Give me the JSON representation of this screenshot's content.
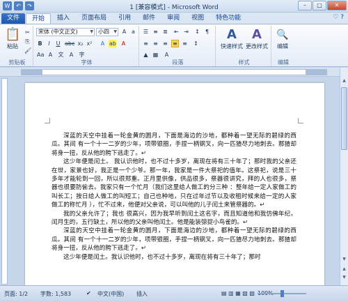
{
  "window": {
    "title": "1 [兼容模式] - Microsoft Word",
    "min_glyph": "–",
    "max_glyph": "□",
    "close_glyph": "✕"
  },
  "qat": {
    "save_glyph": "W",
    "undo_glyph": "↶",
    "redo_glyph": "↷"
  },
  "tabs": [
    "文件",
    "开始",
    "插入",
    "页面布局",
    "引用",
    "邮件",
    "审阅",
    "视图",
    "特色功能"
  ],
  "tabs_right": "♡ ?",
  "ribbon": {
    "clipboard": {
      "label": "剪贴板",
      "paste": "粘贴"
    },
    "font": {
      "label": "字体",
      "name": "宋体 (中文正文)",
      "size": "小四",
      "a_label": "A"
    },
    "paragraph": {
      "label": "段落"
    },
    "styles": {
      "label": "样式",
      "quick_styles": "快速样式",
      "change_styles": "更改样式"
    },
    "editing": {
      "label": "编辑",
      "edit": "编辑"
    }
  },
  "document": {
    "paragraphs": [
      "深蓝的天空中挂着一轮金黄的圆月，下面是海边的沙地，都种着一望无际的碧绿的西瓜。其间 有一个十一二岁的少年，项带银圈，手捏一柄钢叉，向一匹猹尽力地刺去。那猹却将身一扭，反从他的胯下逃走了。↵",
      "这少年便是闰土。 我认识他时，也不过十多岁，离现在将有三十年了；那时我的父亲还在世，家景也好，我正是一个少爷。那一年，我家是一件大祭祀的值年。这祭祀，说是三十多年才能轮到一回，所以很郑重。正月里供像，供品很多，祭器很讲究，拜的人也很多，祭器也很要防偷去。我家只有一个忙月（我们这里给人做工的分三种 ：整年给一定人家做工的叫长工；按日给人做工的叫短工；自己也种地，只在过年过节以及收租时候来给一定的人家做工的称忙月 ），忙不过来，他便对父亲说，可以叫他的儿子闰土来管祭器的。↵",
      "我的父亲允许了；我也 很高兴，因为我早听到闰土这名字，而且知道他和我仿佛年纪，闰月生的，五行缺土，所以他的父亲叫他闰土。他是能装弶捉小鸟雀的。↵",
      "深蓝的天空中挂着一轮金黄的圆月，下面是海边的沙地，都种着一望无际的碧绿的西瓜。其间 有一个十一二岁的少年，项带银圈，手捏一柄钢叉，向一匹猹尽力地刺去。那猹却将身一扭，反从他的胯下逃走了。↵",
      "这少年便是闰土。我认识他时，也不过十多岁，离现在将有三十年了；那时"
    ]
  },
  "status": {
    "page": "页面: 1/2",
    "words": "字数: 1,583",
    "lang": "中文(中国)",
    "mode": "插入",
    "zoom": "100%"
  }
}
